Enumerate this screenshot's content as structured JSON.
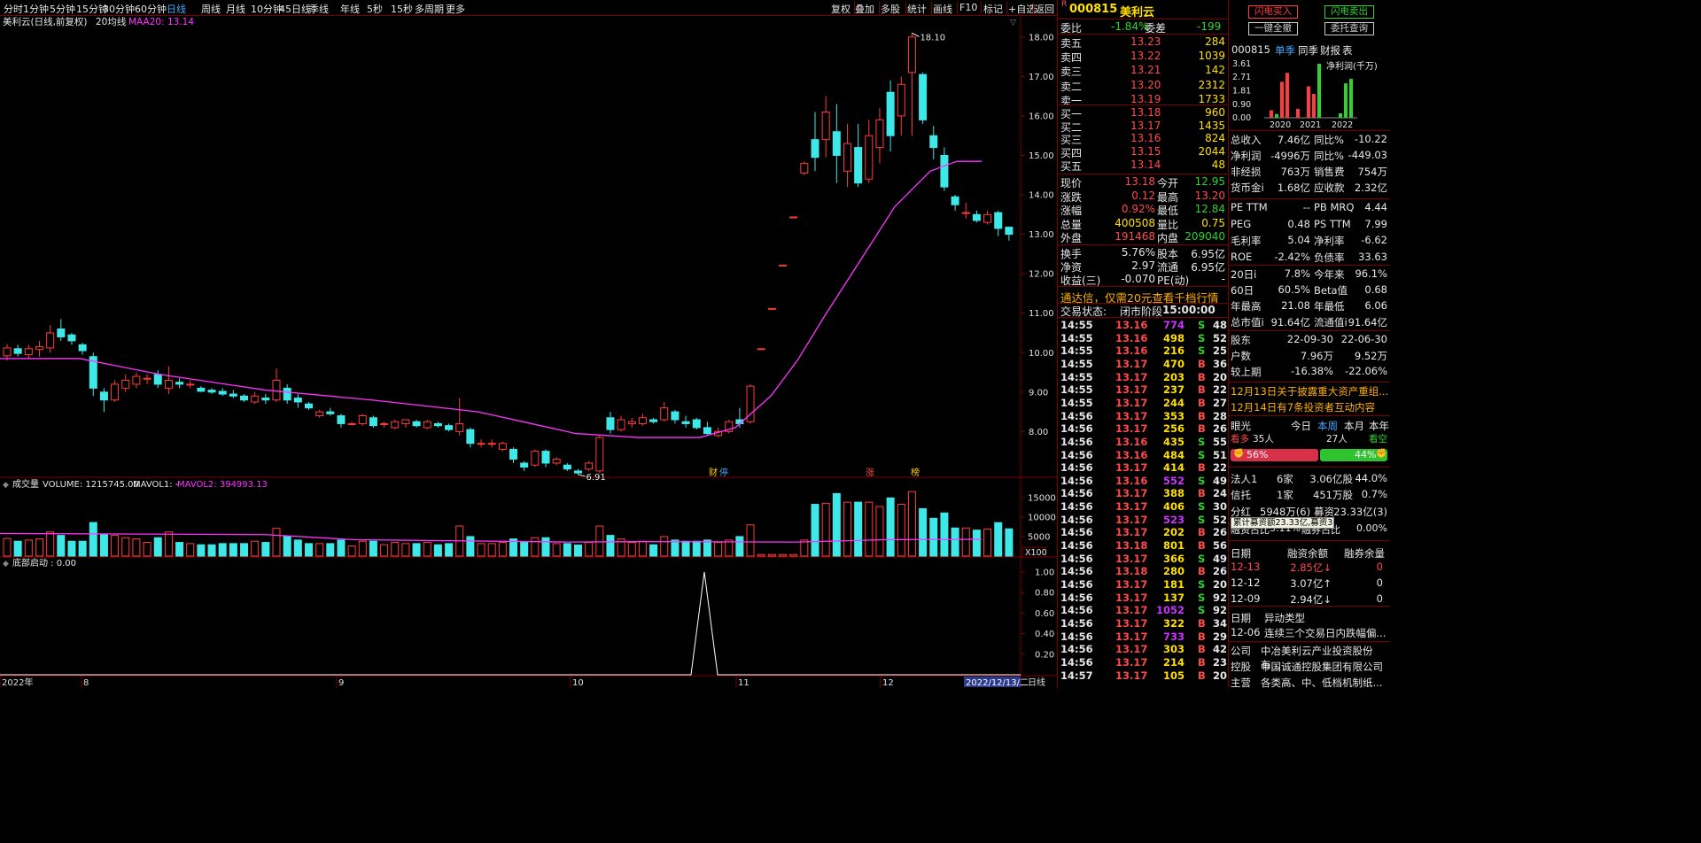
{
  "toolbar": {
    "periods": [
      "分时",
      "1分钟",
      "5分钟",
      "15分钟",
      "30分钟",
      "60分钟",
      "日线",
      "周线",
      "月线",
      "10分钟",
      "45日线",
      "季线",
      "年线",
      "5秒",
      "15秒",
      "多周期",
      "更多"
    ],
    "active": "日线",
    "right_items": [
      "复权",
      "叠加",
      "多股",
      "统计",
      "画线",
      "F10",
      "标记",
      "+自选",
      "返回"
    ]
  },
  "main_chart": {
    "legend_name": "美利云(日线,前复权)",
    "legend_ma": "20均线",
    "legend_value": "MAA20: 13.14",
    "y_ticks": [
      "18.00",
      "17.00",
      "16.00",
      "15.00",
      "14.00",
      "13.00",
      "12.00",
      "11.00",
      "10.00",
      "9.00",
      "8.00"
    ],
    "y_range": [
      7.2,
      18.4
    ],
    "high_label": "18.10",
    "low_label": "6.91",
    "event_markers": [
      "财",
      "停",
      "涨",
      "榜"
    ]
  },
  "volume_panel": {
    "legend_name": "成交量",
    "legend_vol": "VOLUME: 1215745.00",
    "legend_mavol1": "MAVOL1: -",
    "legend_mavol2": "MAVOL2: 394993.13",
    "y_ticks": [
      "15000",
      "10000",
      "5000"
    ],
    "unit": "X100"
  },
  "bottom_panel": {
    "legend": "底部启动 : 0.00",
    "y_ticks": [
      "1.00",
      "0.80",
      "0.60",
      "0.40",
      "0.20"
    ]
  },
  "date_axis": {
    "labels": [
      "2022年",
      "8",
      "9",
      "10",
      "11",
      "12"
    ],
    "current": "2022/12/13/二",
    "right_label": "日线"
  },
  "chart_data": {
    "type": "candlestick",
    "candles": [
      [
        9.92,
        10.12,
        9.8,
        10.22
      ],
      [
        10.1,
        9.98,
        9.9,
        10.2
      ],
      [
        9.95,
        10.1,
        9.85,
        10.2
      ],
      [
        10.08,
        10.15,
        9.9,
        10.3
      ],
      [
        10.12,
        10.5,
        10.0,
        10.7
      ],
      [
        10.6,
        10.4,
        10.3,
        10.85
      ],
      [
        10.45,
        10.3,
        10.2,
        10.5
      ],
      [
        10.2,
        10.05,
        9.95,
        10.25
      ],
      [
        9.9,
        9.1,
        8.9,
        10.0
      ],
      [
        9.0,
        8.8,
        8.5,
        9.1
      ],
      [
        8.8,
        9.2,
        8.75,
        9.3
      ],
      [
        9.1,
        9.3,
        9.0,
        9.45
      ],
      [
        9.2,
        9.4,
        9.1,
        9.5
      ],
      [
        9.35,
        9.35,
        9.2,
        9.45
      ],
      [
        9.45,
        9.2,
        9.1,
        9.55
      ],
      [
        9.1,
        9.3,
        8.95,
        9.65
      ],
      [
        9.25,
        9.2,
        9.1,
        9.35
      ],
      [
        9.2,
        9.2,
        9.1,
        9.3
      ],
      [
        9.1,
        9.02,
        9.0,
        9.15
      ],
      [
        9.05,
        9.0,
        8.95,
        9.1
      ],
      [
        9.02,
        8.95,
        8.9,
        9.1
      ],
      [
        8.95,
        8.9,
        8.85,
        9.05
      ],
      [
        8.9,
        8.8,
        8.75,
        8.95
      ],
      [
        8.75,
        8.9,
        8.7,
        9.0
      ],
      [
        8.85,
        8.8,
        8.7,
        8.95
      ],
      [
        8.8,
        9.3,
        8.75,
        9.6
      ],
      [
        9.1,
        8.8,
        8.7,
        9.2
      ],
      [
        8.85,
        8.75,
        8.6,
        8.95
      ],
      [
        8.7,
        8.6,
        8.55,
        8.75
      ],
      [
        8.4,
        8.5,
        8.35,
        8.55
      ],
      [
        8.5,
        8.45,
        8.4,
        8.6
      ],
      [
        8.4,
        8.2,
        8.1,
        8.45
      ],
      [
        8.2,
        8.2,
        8.15,
        8.25
      ],
      [
        8.2,
        8.4,
        8.15,
        8.45
      ],
      [
        8.35,
        8.15,
        8.1,
        8.4
      ],
      [
        8.2,
        8.2,
        8.1,
        8.25
      ],
      [
        8.1,
        8.25,
        8.05,
        8.3
      ],
      [
        8.2,
        8.3,
        8.1,
        8.3
      ],
      [
        8.25,
        8.15,
        8.1,
        8.3
      ],
      [
        8.1,
        8.25,
        8.05,
        8.3
      ],
      [
        8.2,
        8.15,
        8.1,
        8.25
      ],
      [
        8.15,
        8.05,
        8.0,
        8.2
      ],
      [
        8.0,
        8.2,
        7.9,
        8.85
      ],
      [
        8.05,
        7.7,
        7.6,
        8.1
      ],
      [
        7.7,
        7.7,
        7.6,
        7.8
      ],
      [
        7.7,
        7.7,
        7.6,
        7.8
      ],
      [
        7.55,
        7.7,
        7.5,
        7.75
      ],
      [
        7.55,
        7.3,
        7.2,
        7.6
      ],
      [
        7.2,
        7.1,
        7.0,
        7.25
      ],
      [
        7.15,
        7.5,
        7.1,
        7.55
      ],
      [
        7.5,
        7.2,
        7.1,
        7.55
      ],
      [
        7.2,
        7.3,
        7.15,
        7.35
      ],
      [
        7.15,
        7.05,
        7.0,
        7.2
      ],
      [
        7.0,
        6.95,
        6.91,
        7.05
      ],
      [
        7.05,
        7.2,
        7.0,
        7.25
      ],
      [
        7.0,
        7.85,
        6.95,
        7.9
      ],
      [
        8.35,
        8.05,
        7.95,
        8.5
      ],
      [
        8.05,
        8.3,
        8.0,
        8.4
      ],
      [
        8.2,
        8.25,
        8.1,
        8.35
      ],
      [
        8.2,
        8.35,
        8.15,
        8.45
      ],
      [
        8.3,
        8.25,
        8.2,
        8.35
      ],
      [
        8.3,
        8.6,
        8.25,
        8.75
      ],
      [
        8.5,
        8.3,
        8.2,
        8.55
      ],
      [
        8.25,
        8.2,
        8.1,
        8.4
      ],
      [
        8.3,
        8.1,
        8.05,
        8.35
      ],
      [
        8.1,
        7.95,
        7.9,
        8.25
      ],
      [
        7.9,
        8.0,
        7.85,
        8.1
      ],
      [
        8.0,
        8.25,
        7.95,
        8.3
      ],
      [
        8.3,
        8.2,
        8.1,
        8.6
      ],
      [
        8.25,
        9.15,
        8.2,
        9.2
      ],
      [
        10.1,
        10.1,
        10.1,
        10.1
      ],
      [
        11.12,
        11.12,
        11.12,
        11.12
      ],
      [
        12.22,
        12.22,
        12.22,
        12.22
      ],
      [
        13.44,
        13.44,
        13.44,
        13.44
      ],
      [
        14.55,
        14.8,
        14.5,
        14.85
      ],
      [
        15.4,
        14.95,
        14.6,
        16.1
      ],
      [
        15.4,
        16.1,
        14.95,
        16.5
      ],
      [
        15.6,
        15.0,
        14.3,
        16.3
      ],
      [
        14.6,
        15.3,
        14.2,
        15.8
      ],
      [
        15.2,
        14.3,
        14.2,
        15.8
      ],
      [
        14.4,
        15.5,
        14.3,
        15.9
      ],
      [
        15.2,
        15.9,
        14.8,
        16.2
      ],
      [
        16.6,
        15.5,
        15.1,
        16.9
      ],
      [
        16.0,
        16.8,
        15.5,
        17.0
      ],
      [
        17.1,
        18.0,
        15.5,
        18.1
      ],
      [
        17.05,
        15.9,
        15.8,
        17.1
      ],
      [
        15.5,
        15.2,
        14.9,
        15.75
      ],
      [
        15.0,
        14.2,
        14.1,
        15.2
      ],
      [
        13.95,
        13.75,
        13.6,
        14.0
      ],
      [
        13.55,
        13.55,
        13.4,
        13.8
      ],
      [
        13.5,
        13.35,
        13.3,
        13.6
      ],
      [
        13.3,
        13.5,
        13.25,
        13.6
      ],
      [
        13.55,
        13.15,
        12.95,
        13.6
      ],
      [
        13.18,
        13.0,
        12.84,
        13.2
      ]
    ],
    "ma20": [
      [
        0,
        9.85
      ],
      [
        90,
        9.85
      ],
      [
        180,
        9.45
      ],
      [
        300,
        9.05
      ],
      [
        420,
        8.8
      ],
      [
        540,
        8.5
      ],
      [
        600,
        8.2
      ],
      [
        650,
        7.95
      ],
      [
        720,
        7.85
      ],
      [
        790,
        7.85
      ],
      [
        830,
        8.1
      ],
      [
        870,
        8.9
      ],
      [
        900,
        9.8
      ],
      [
        930,
        10.9
      ],
      [
        970,
        12.3
      ],
      [
        1010,
        13.7
      ],
      [
        1050,
        14.6
      ],
      [
        1080,
        14.85
      ],
      [
        1108,
        14.85
      ]
    ]
  },
  "quote": {
    "badge": "R",
    "code": "000815",
    "name": "美利云",
    "weibi_label": "委比",
    "weibi": "-1.84%",
    "weicha_label": "委差",
    "weicha": "-199",
    "asks": [
      {
        "label": "卖五",
        "price": "13.23",
        "vol": "284"
      },
      {
        "label": "卖四",
        "price": "13.22",
        "vol": "1039"
      },
      {
        "label": "卖三",
        "price": "13.21",
        "vol": "142"
      },
      {
        "label": "卖二",
        "price": "13.20",
        "vol": "2312"
      },
      {
        "label": "卖一",
        "price": "13.19",
        "vol": "1733"
      }
    ],
    "bids": [
      {
        "label": "买一",
        "price": "13.18",
        "vol": "960"
      },
      {
        "label": "买二",
        "price": "13.17",
        "vol": "1435"
      },
      {
        "label": "买三",
        "price": "13.16",
        "vol": "824"
      },
      {
        "label": "买四",
        "price": "13.15",
        "vol": "2044"
      },
      {
        "label": "买五",
        "price": "13.14",
        "vol": "48"
      }
    ],
    "stats": [
      {
        "l1": "现价",
        "v1": "13.18",
        "c1": "red",
        "l2": "今开",
        "v2": "12.95",
        "c2": "grn"
      },
      {
        "l1": "涨跌",
        "v1": "0.12",
        "c1": "red",
        "l2": "最高",
        "v2": "13.20",
        "c2": "red"
      },
      {
        "l1": "涨幅",
        "v1": "0.92%",
        "c1": "red",
        "l2": "最低",
        "v2": "12.84",
        "c2": "grn"
      },
      {
        "l1": "总量",
        "v1": "400508",
        "c1": "yel",
        "l2": "量比",
        "v2": "0.75",
        "c2": "yel"
      },
      {
        "l1": "外盘",
        "v1": "191468",
        "c1": "red",
        "l2": "内盘",
        "v2": "209040",
        "c2": "grn"
      }
    ],
    "stats2": [
      {
        "l1": "换手",
        "v1": "5.76%",
        "l2": "股本",
        "v2": "6.95亿"
      },
      {
        "l1": "净资",
        "v1": "2.97",
        "l2": "流通",
        "v2": "6.95亿"
      },
      {
        "l1": "收益(三)",
        "v1": "-0.070",
        "l2": "PE(动)",
        "v2": "-"
      }
    ],
    "promo": "通达信，仅需20元查看千档行情",
    "trade_state_label": "交易状态:",
    "trade_state": "闭市阶段",
    "trade_time": "15:00:00"
  },
  "ticks": [
    [
      "14:55",
      "13.16",
      "774",
      "S",
      "48",
      "cyan"
    ],
    [
      "14:55",
      "13.16",
      "498",
      "S",
      "52",
      "yel"
    ],
    [
      "14:55",
      "13.16",
      "216",
      "S",
      "25",
      "yel"
    ],
    [
      "14:55",
      "13.17",
      "470",
      "B",
      "36",
      "yel"
    ],
    [
      "14:55",
      "13.17",
      "203",
      "B",
      "20",
      "yel"
    ],
    [
      "14:55",
      "13.17",
      "237",
      "B",
      "22",
      "yel"
    ],
    [
      "14:55",
      "13.17",
      "244",
      "B",
      "27",
      "yel"
    ],
    [
      "14:56",
      "13.17",
      "353",
      "B",
      "28",
      "yel"
    ],
    [
      "14:56",
      "13.17",
      "256",
      "B",
      "26",
      "yel"
    ],
    [
      "14:56",
      "13.16",
      "435",
      "S",
      "55",
      "yel"
    ],
    [
      "14:56",
      "13.16",
      "484",
      "S",
      "51",
      "yel"
    ],
    [
      "14:56",
      "13.17",
      "414",
      "B",
      "22",
      "yel"
    ],
    [
      "14:56",
      "13.16",
      "552",
      "S",
      "49",
      "cyan"
    ],
    [
      "14:56",
      "13.17",
      "388",
      "B",
      "24",
      "yel"
    ],
    [
      "14:56",
      "13.17",
      "406",
      "S",
      "30",
      "yel"
    ],
    [
      "14:56",
      "13.17",
      "523",
      "S",
      "52",
      "cyan"
    ],
    [
      "14:56",
      "13.17",
      "202",
      "B",
      "26",
      "yel"
    ],
    [
      "14:56",
      "13.18",
      "801",
      "B",
      "56",
      "yel"
    ],
    [
      "14:56",
      "13.17",
      "366",
      "S",
      "49",
      "yel"
    ],
    [
      "14:56",
      "13.18",
      "280",
      "B",
      "26",
      "yel"
    ],
    [
      "14:56",
      "13.17",
      "181",
      "S",
      "20",
      "yel"
    ],
    [
      "14:56",
      "13.17",
      "137",
      "S",
      "92",
      "yel"
    ],
    [
      "14:56",
      "13.17",
      "1052",
      "S",
      "92",
      "cyan"
    ],
    [
      "14:56",
      "13.17",
      "322",
      "B",
      "34",
      "yel"
    ],
    [
      "14:56",
      "13.17",
      "733",
      "B",
      "29",
      "cyan"
    ],
    [
      "14:56",
      "13.17",
      "303",
      "B",
      "42",
      "yel"
    ],
    [
      "14:56",
      "13.17",
      "214",
      "B",
      "23",
      "yel"
    ],
    [
      "14:57",
      "13.17",
      "105",
      "B",
      "20",
      "yel"
    ]
  ],
  "f10": {
    "btn_buy": "闪电买入",
    "btn_sell": "闪电卖出",
    "btn_cancel": "一键全撤",
    "btn_query": "委托查询",
    "code": "000815",
    "tabs": [
      "单季",
      "同季",
      "财报",
      "表"
    ],
    "chart_title": "净利润(千万)",
    "y_ticks": [
      "3.61",
      "2.71",
      "1.81",
      "0.90",
      "0.00"
    ],
    "years": [
      "2020",
      "2021",
      "2022"
    ],
    "bars": [
      {
        "v": 0.5,
        "c": "red"
      },
      {
        "v": 0.25,
        "c": "grn"
      },
      {
        "v": 2.4,
        "c": "red"
      },
      {
        "v": 3.0,
        "c": "red"
      },
      {
        "v": 0.6,
        "c": "red"
      },
      {
        "v": 2.1,
        "c": "red"
      },
      {
        "v": 1.6,
        "c": "red"
      },
      {
        "v": 3.61,
        "c": "grn"
      },
      {
        "v": 0.3,
        "c": "grn"
      },
      {
        "v": 2.3,
        "c": "grn"
      },
      {
        "v": 2.6,
        "c": "grn"
      }
    ],
    "fin": [
      [
        "总收入",
        "7.46亿",
        "同比%",
        "-10.22"
      ],
      [
        "净利润",
        "-4996万",
        "同比%",
        "-449.03"
      ],
      [
        "非经损",
        "763万",
        "销售费",
        "754万"
      ],
      [
        "货币金i",
        "1.68亿",
        "应收款",
        "2.32亿"
      ]
    ],
    "val": [
      [
        "PE TTM",
        "--",
        "PB MRQ",
        "4.44"
      ],
      [
        "PEG",
        "0.48",
        "PS TTM",
        "7.99"
      ],
      [
        "毛利率",
        "5.04",
        "净利率",
        "-6.62"
      ],
      [
        "ROE",
        "-2.42%",
        "负债率",
        "33.63"
      ]
    ],
    "perf": [
      [
        "20日i",
        "7.8%",
        "今年来",
        "96.1%"
      ],
      [
        "60日",
        "60.5%",
        "Beta值",
        "0.68"
      ],
      [
        "年最高",
        "21.08",
        "年最低",
        "6.06"
      ],
      [
        "总市值i",
        "91.64亿",
        "流通值i",
        "91.64亿"
      ]
    ],
    "holders": [
      [
        "股东",
        "22-09-30",
        "22-06-30"
      ],
      [
        "户数",
        "7.96万",
        "9.52万"
      ],
      [
        "较上期",
        "-16.38%",
        "-22.06%"
      ]
    ],
    "news": [
      "12月13日关于披露重大资产重组...",
      "12月14日有7条投资者互动内容"
    ],
    "eye": {
      "label": "眼光",
      "tabs": [
        "今日",
        "本周",
        "本月",
        "本年"
      ],
      "bull": "看多",
      "bull_n": "35人",
      "bear_n": "27人",
      "bear": "看空",
      "bull_pct": "56%",
      "bear_pct": "44%"
    },
    "inst": [
      [
        "法人1",
        "6家",
        "3.06亿股",
        "44.0%"
      ],
      [
        "信托",
        "1家",
        "451万股",
        "0.7%"
      ]
    ],
    "div": [
      "分红",
      "5948万(6)",
      "募资",
      "23.33亿(3)"
    ],
    "tooltip": "累计募资额23.33亿,募资3次",
    "margin_partial": [
      "融资占比",
      "3.11%",
      "融券占比",
      "0.00%"
    ],
    "margin_hdr": [
      "日期",
      "融资余额",
      "融券余量"
    ],
    "margin": [
      [
        "12-13",
        "2.85亿↓",
        "0",
        "red"
      ],
      [
        "12-12",
        "3.07亿↑",
        "0",
        "wht"
      ],
      [
        "12-09",
        "2.94亿↓",
        "0",
        "wht"
      ]
    ],
    "abn_hdr": [
      "日期",
      "异动类型"
    ],
    "abn": [
      "12-06",
      "连续三个交易日内跌幅偏..."
    ],
    "company": [
      [
        "公司",
        "中冶美利云产业投资股份有..."
      ],
      [
        "控股",
        "中国诚通控股集团有限公司"
      ],
      [
        "主营",
        "各类高、中、低档机制纸..."
      ]
    ]
  }
}
